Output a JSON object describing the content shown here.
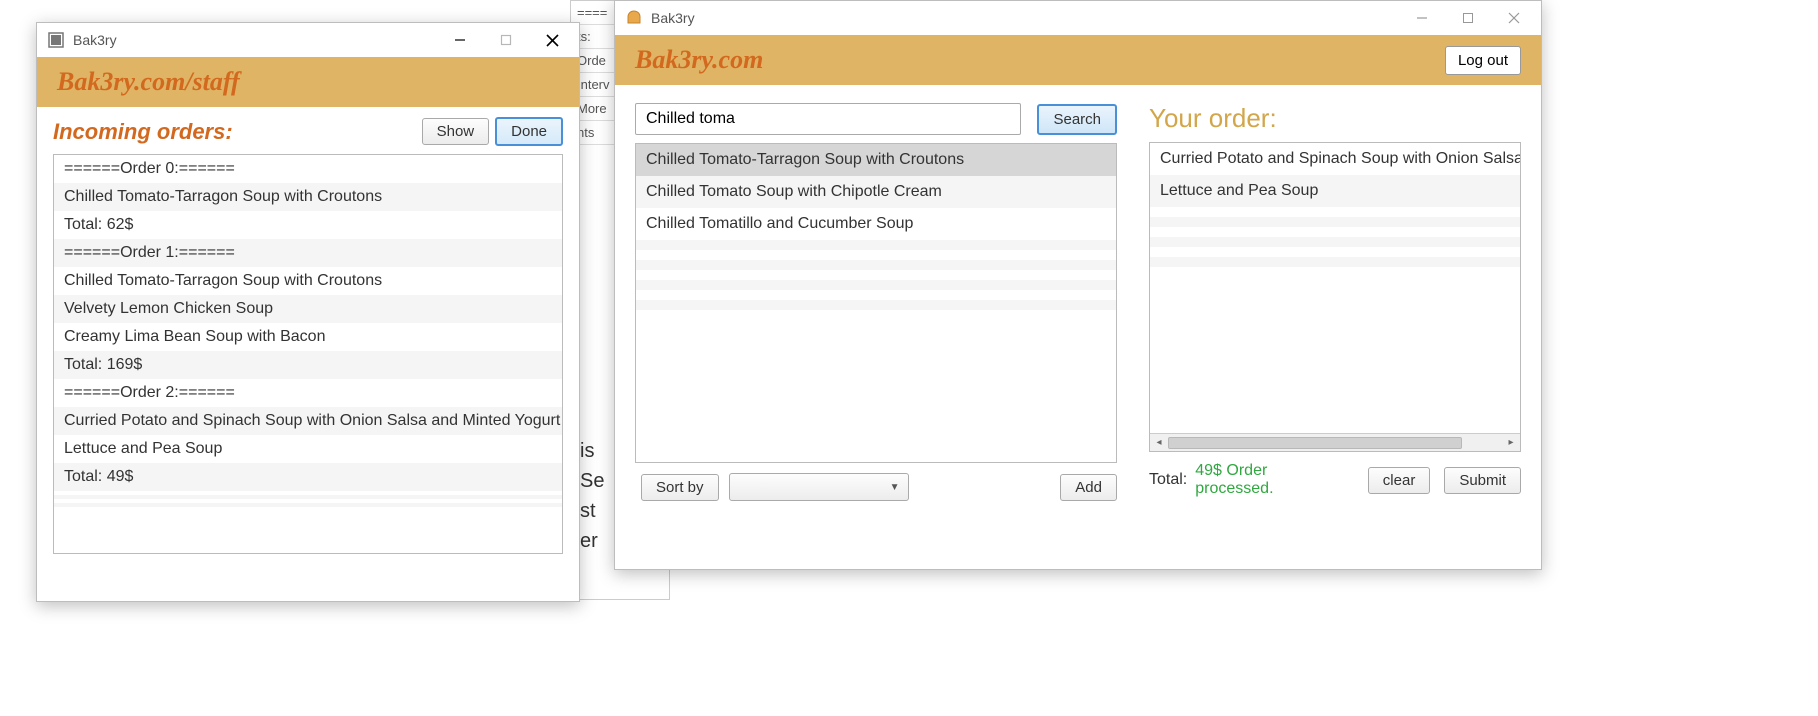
{
  "background": {
    "rows": [
      "====",
      "ts:",
      "Orde",
      "Interv",
      "More",
      "nts"
    ],
    "lines": [
      "is",
      "Se",
      "st",
      "er"
    ]
  },
  "staff": {
    "title": "Bak3ry",
    "brand": "Bak3ry.com/staff",
    "heading": "Incoming orders:",
    "show_label": "Show",
    "done_label": "Done",
    "orders": [
      {
        "header": "======Order 0:======",
        "lines": [
          "Chilled Tomato-Tarragon Soup with Croutons"
        ],
        "total": "Total: 62$"
      },
      {
        "header": "======Order 1:======",
        "lines": [
          "Chilled Tomato-Tarragon Soup with Croutons",
          "Velvety Lemon Chicken Soup",
          "Creamy Lima Bean Soup with Bacon"
        ],
        "total": "Total: 169$"
      },
      {
        "header": "======Order 2:======",
        "lines": [
          "Curried Potato and Spinach Soup with Onion Salsa and Minted Yogurt",
          "Lettuce and Pea Soup"
        ],
        "total": "Total: 49$"
      }
    ]
  },
  "customer": {
    "title": "Bak3ry",
    "brand": "Bak3ry.com",
    "logout_label": "Log out",
    "search_value": "Chilled toma",
    "search_label": "Search",
    "results": [
      {
        "text": "Chilled Tomato-Tarragon Soup with Croutons",
        "selected": true
      },
      {
        "text": "Chilled Tomato Soup with Chipotle Cream",
        "selected": false
      },
      {
        "text": "Chilled Tomatillo and Cucumber Soup",
        "selected": false
      }
    ],
    "sort_by_label": "Sort by",
    "add_label": "Add",
    "your_order_title": "Your order:",
    "order_items": [
      "Curried Potato and Spinach Soup with Onion Salsa a",
      "Lettuce and Pea Soup"
    ],
    "total_label": "Total:",
    "total_value": "49$ Order processed.",
    "clear_label": "clear",
    "submit_label": "Submit"
  }
}
